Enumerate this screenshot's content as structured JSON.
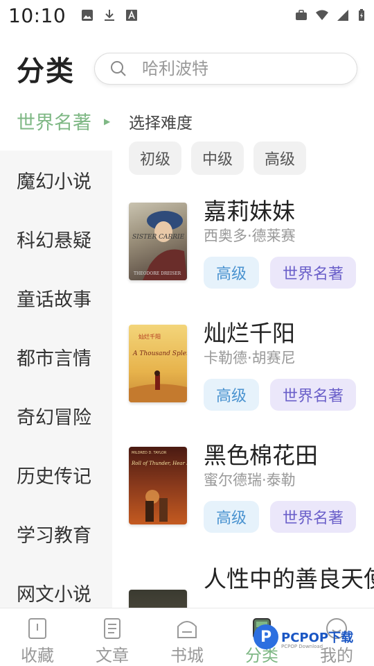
{
  "status_bar": {
    "time": "10:10",
    "left_icons": [
      "image-icon",
      "download-icon",
      "font-icon"
    ],
    "right_icons": [
      "briefcase-icon",
      "wifi-icon",
      "signal-icon",
      "battery-icon"
    ]
  },
  "header": {
    "title": "分类",
    "search_placeholder": "哈利波特"
  },
  "sidebar": {
    "items": [
      {
        "label": "世界名著",
        "active": true
      },
      {
        "label": "魔幻小说"
      },
      {
        "label": "科幻悬疑"
      },
      {
        "label": "童话故事"
      },
      {
        "label": "都市言情"
      },
      {
        "label": "奇幻冒险"
      },
      {
        "label": "历史传记"
      },
      {
        "label": "学习教育"
      },
      {
        "label": "网文小说"
      }
    ]
  },
  "content": {
    "difficulty_title": "选择难度",
    "difficulty_options": [
      "初级",
      "中级",
      "高级"
    ],
    "books": [
      {
        "title": "嘉莉妹妹",
        "author": "西奥多·德莱赛",
        "level": "高级",
        "category": "世界名著",
        "cover_text": "SISTER CARRIE",
        "cover_author": "THEODORE DREISER"
      },
      {
        "title": "灿烂千阳",
        "author": "卡勒德·胡赛尼",
        "level": "高级",
        "category": "世界名著",
        "cover_text": "A Thousand Splendid Suns",
        "cover_author": "灿烂千阳"
      },
      {
        "title": "黑色棉花田",
        "author": "蜜尔德瑞·泰勒",
        "level": "高级",
        "category": "世界名著",
        "cover_text": "Roll of Thunder, Hear My Cry",
        "cover_author": "MILDRED D. TAYLOR"
      },
      {
        "title": "人性中的善良天使",
        "author": "",
        "level": "",
        "category": "",
        "cover_text": "",
        "cover_author": ""
      }
    ]
  },
  "bottom_nav": [
    {
      "label": "收藏",
      "icon": "bookmark-icon"
    },
    {
      "label": "文章",
      "icon": "article-icon"
    },
    {
      "label": "书城",
      "icon": "bookstore-icon"
    },
    {
      "label": "分类",
      "icon": "category-icon",
      "active": true
    },
    {
      "label": "我的",
      "icon": "profile-icon"
    }
  ],
  "watermark": {
    "text": "PCPOP下载",
    "sub": "PCPOP Download"
  },
  "colors": {
    "accent": "#7fb885",
    "level_tag_bg": "#e6f2fb",
    "level_tag_fg": "#4a93d0",
    "category_tag_bg": "#ebe7fa",
    "category_tag_fg": "#6a5fc9"
  }
}
